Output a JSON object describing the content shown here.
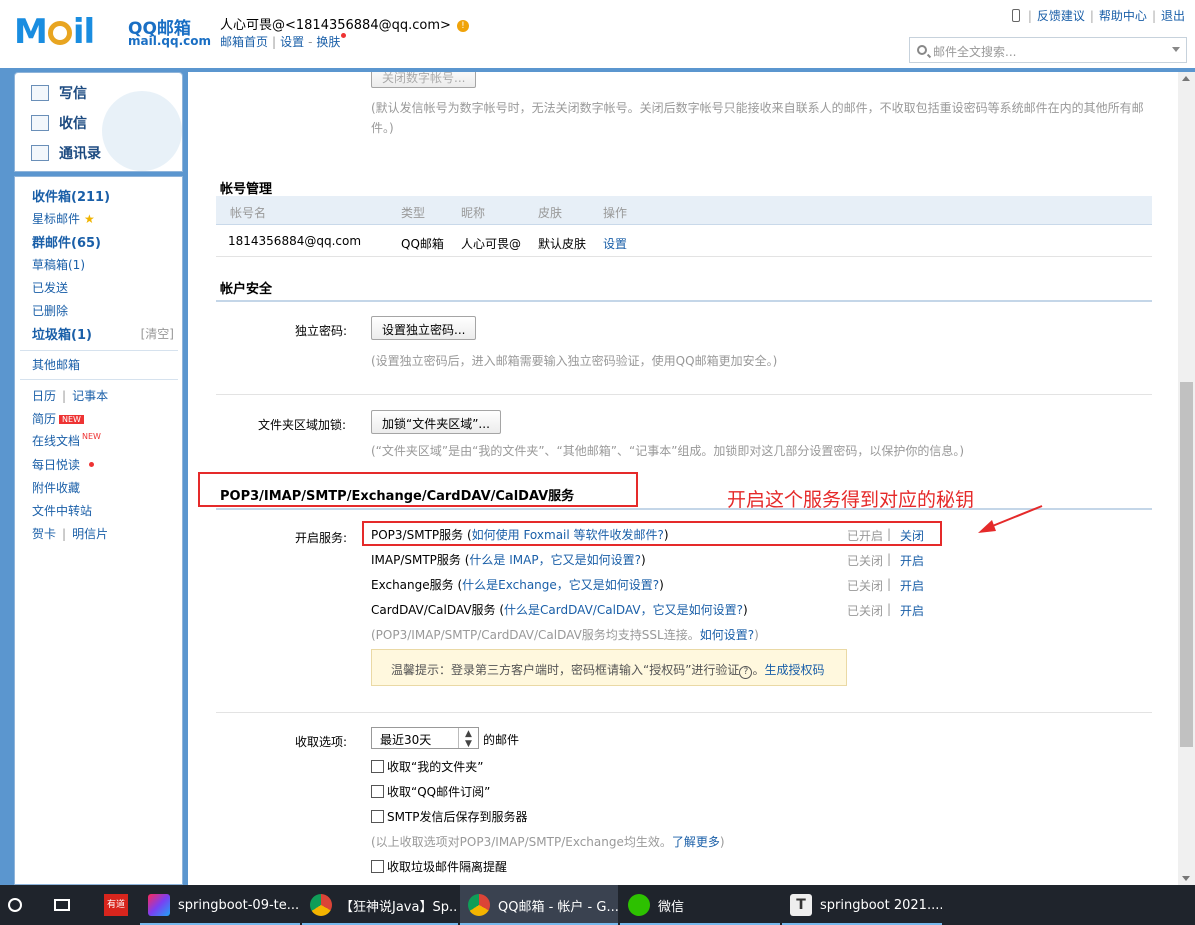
{
  "header": {
    "logo_text": "M il",
    "brand": "QQ邮箱",
    "domain": "mail.qq.com",
    "user": "人心可畏@<1814356884@qq.com>",
    "nav": [
      "邮箱首页",
      "设置",
      "换肤"
    ],
    "top_links": [
      "反馈建议",
      "帮助中心",
      "退出"
    ],
    "search_placeholder": "邮件全文搜索..."
  },
  "sidebar": {
    "actions": [
      "写信",
      "收信",
      "通讯录"
    ],
    "folders": [
      {
        "label": "收件箱(211)"
      },
      {
        "label": "星标邮件"
      },
      {
        "label": "群邮件(65)"
      },
      {
        "label": "草稿箱(1)"
      },
      {
        "label": "已发送"
      },
      {
        "label": "已删除"
      },
      {
        "label": "垃圾箱(1)",
        "extra": "[清空]"
      }
    ],
    "other": "其他邮箱",
    "calendar": "日历",
    "notebook": "记事本",
    "resume": "简历",
    "new_badge": "NEW",
    "docs": "在线文档",
    "daily": "每日悦读",
    "attachments": "附件收藏",
    "transfer": "文件中转站",
    "cards": "贺卡",
    "postcard": "明信片"
  },
  "content": {
    "cut_button": "关闭数字帐号...",
    "note_digital": "(默认发信帐号为数字帐号时，无法关闭数字帐号。关闭后数字帐号只能接收来自联系人的邮件，不收取包括重设密码等系统邮件在内的其他所有邮",
    "note_digital2": "件。)",
    "account_title": "帐号管理",
    "account_headers": [
      "帐号名",
      "类型",
      "昵称",
      "皮肤",
      "操作"
    ],
    "account_row": [
      "1814356884@qq.com",
      "QQ邮箱",
      "人心可畏@",
      "默认皮肤",
      "设置"
    ],
    "security_title": "帐户安全",
    "pwd_label": "独立密码:",
    "pwd_button": "设置独立密码...",
    "pwd_note": "(设置独立密码后，进入邮箱需要输入独立密码验证，使用QQ邮箱更加安全。)",
    "folder_lock_label": "文件夹区域加锁:",
    "folder_lock_button": "加锁“文件夹区域”...",
    "folder_lock_note": "(“文件夹区域”是由“我的文件夹”、“其他邮箱”、“记事本”组成。加锁即对这几部分设置密码，以保护你的信息。)",
    "pop_title": "POP3/IMAP/SMTP/Exchange/CardDAV/CalDAV服务",
    "service_label": "开启服务:",
    "services": [
      {
        "name": "POP3/SMTP服务 (",
        "link": "如何使用 Foxmail 等软件收发邮件?",
        "tail": ")",
        "status": "已开启",
        "action": "关闭"
      },
      {
        "name": "IMAP/SMTP服务 (",
        "link": "什么是 IMAP，它又是如何设置?",
        "tail": ")",
        "status": "已关闭",
        "action": "开启"
      },
      {
        "name": "Exchange服务 (",
        "link": "什么是Exchange，它又是如何设置?",
        "tail": ")",
        "status": "已关闭",
        "action": "开启"
      },
      {
        "name": "CardDAV/CalDAV服务 (",
        "link": "什么是CardDAV/CalDAV，它又是如何设置?",
        "tail": ")",
        "status": "已关闭",
        "action": "开启"
      }
    ],
    "ssl_note": "(POP3/IMAP/SMTP/CardDAV/CalDAV服务均支持SSL连接。",
    "ssl_link": "如何设置?",
    "ssl_tail": ")",
    "tip_text": "温馨提示：登录第三方客户端时，密码框请输入“授权码”进行验证",
    "tip_q": "?",
    "tip_link": "生成授权码",
    "receive_label": "收取选项:",
    "receive_select": "最近30天",
    "receive_suffix": "的邮件",
    "options": [
      "收取“我的文件夹”",
      "收取“QQ邮件订阅”",
      "SMTP发信后保存到服务器"
    ],
    "options_note": "(以上收取选项对POP3/IMAP/SMTP/Exchange均生效。",
    "options_link": "了解更多",
    "options_tail": ")",
    "spam_option": "收取垃圾邮件隔离提醒"
  },
  "annotation": {
    "text": "开启这个服务得到对应的秘钥",
    "color": "#e52a2a"
  },
  "taskbar": {
    "items": [
      {
        "label": "springboot-09-te..."
      },
      {
        "label": "【狂神说Java】Sp..."
      },
      {
        "label": "QQ邮箱 - 帐户 - G..."
      },
      {
        "label": "微信"
      },
      {
        "label": "springboot 2021...."
      }
    ],
    "youdao": "有道"
  },
  "colors": {
    "accent": "#1a5fa8",
    "frame": "#5b96cf",
    "highlight": "#e52a2a"
  }
}
